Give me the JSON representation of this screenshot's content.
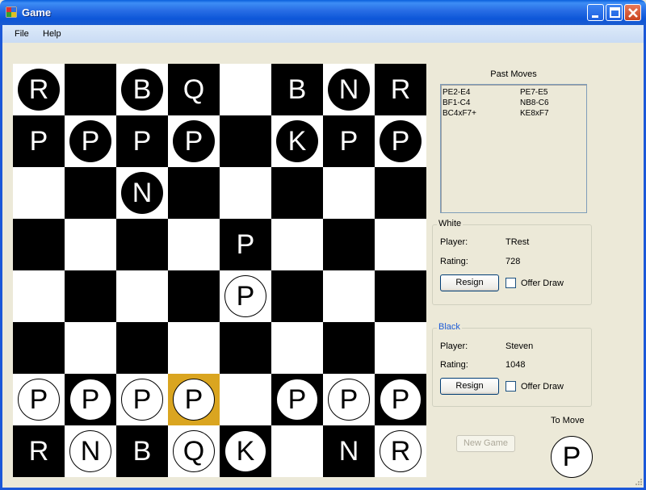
{
  "window": {
    "title": "Game"
  },
  "menu": {
    "items": [
      "File",
      "Help"
    ]
  },
  "board": {
    "selected_square": "d2",
    "rows": [
      [
        {
          "c": "black",
          "l": "R"
        },
        null,
        {
          "c": "black",
          "l": "B"
        },
        {
          "c": "white",
          "l": "Q",
          "bare": true
        },
        null,
        {
          "c": "white",
          "l": "B",
          "bare": true
        },
        {
          "c": "black",
          "l": "N"
        },
        {
          "c": "white",
          "l": "R",
          "bare": true
        }
      ],
      [
        {
          "c": "white",
          "l": "P",
          "bare": true
        },
        {
          "c": "black",
          "l": "P"
        },
        {
          "c": "white",
          "l": "P",
          "bare": true
        },
        {
          "c": "black",
          "l": "P"
        },
        null,
        {
          "c": "black",
          "l": "K"
        },
        {
          "c": "white",
          "l": "P",
          "bare": true
        },
        {
          "c": "black",
          "l": "P"
        }
      ],
      [
        null,
        null,
        {
          "c": "black",
          "l": "N"
        },
        null,
        null,
        null,
        null,
        null
      ],
      [
        null,
        null,
        null,
        null,
        {
          "c": "white",
          "l": "P",
          "bare": true
        },
        null,
        null,
        null
      ],
      [
        null,
        null,
        null,
        null,
        {
          "c": "white",
          "l": "P"
        },
        null,
        null,
        null
      ],
      [
        null,
        null,
        null,
        null,
        null,
        null,
        null,
        null
      ],
      [
        {
          "c": "white",
          "l": "P"
        },
        {
          "c": "white",
          "l": "P"
        },
        {
          "c": "white",
          "l": "P"
        },
        {
          "c": "white",
          "l": "P"
        },
        null,
        {
          "c": "white",
          "l": "P"
        },
        {
          "c": "white",
          "l": "P"
        },
        {
          "c": "white",
          "l": "P"
        }
      ],
      [
        {
          "c": "black",
          "l": "R",
          "bare": true
        },
        {
          "c": "white",
          "l": "N"
        },
        {
          "c": "black",
          "l": "B",
          "bare": true
        },
        {
          "c": "white",
          "l": "Q"
        },
        {
          "c": "white",
          "l": "K"
        },
        null,
        {
          "c": "black",
          "l": "N",
          "bare": true
        },
        {
          "c": "white",
          "l": "R"
        }
      ]
    ]
  },
  "past_moves": {
    "title": "Past Moves",
    "white": [
      "PE2-E4",
      "BF1-C4",
      "BC4xF7+"
    ],
    "black": [
      "PE7-E5",
      "NB8-C6",
      "KE8xF7"
    ]
  },
  "white_panel": {
    "title": "White",
    "player_label": "Player:",
    "player": "TRest",
    "rating_label": "Rating:",
    "rating": "728",
    "resign_label": "Resign",
    "offer_draw_label": "Offer Draw"
  },
  "black_panel": {
    "title": "Black",
    "player_label": "Player:",
    "player": "Steven",
    "rating_label": "Rating:",
    "rating": "1048",
    "resign_label": "Resign",
    "offer_draw_label": "Offer Draw"
  },
  "to_move": {
    "label": "To Move",
    "piece": "P"
  },
  "new_game_label": "New Game",
  "colors": {
    "selected": "#daa520",
    "black_title": "#1c5bd6"
  }
}
